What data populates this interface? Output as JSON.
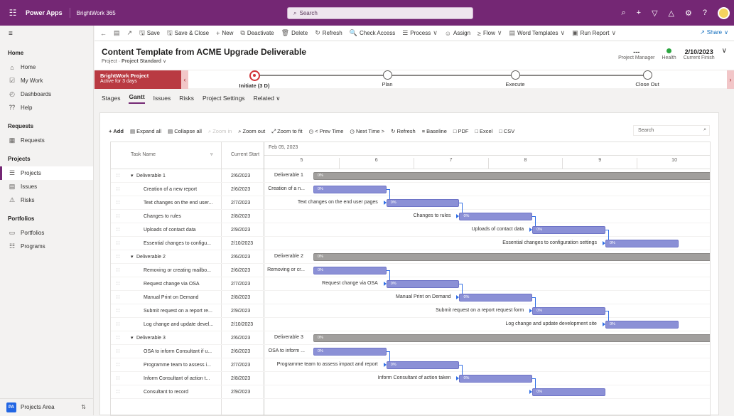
{
  "topbar": {
    "app": "Power Apps",
    "env": "BrightWork 365",
    "search_placeholder": "Search"
  },
  "sidebar": {
    "groups": [
      {
        "title": "Home",
        "items": [
          {
            "label": "Home",
            "icon": "home-icon"
          },
          {
            "label": "My Work",
            "icon": "checkbox-icon"
          },
          {
            "label": "Dashboards",
            "icon": "dashboard-icon"
          },
          {
            "label": "Help",
            "icon": "help-icon"
          }
        ]
      },
      {
        "title": "Requests",
        "items": [
          {
            "label": "Requests",
            "icon": "requests-icon"
          }
        ]
      },
      {
        "title": "Projects",
        "items": [
          {
            "label": "Projects",
            "icon": "projects-icon",
            "active": true
          },
          {
            "label": "Issues",
            "icon": "issues-icon"
          },
          {
            "label": "Risks",
            "icon": "warning-icon"
          }
        ]
      },
      {
        "title": "Portfolios",
        "items": [
          {
            "label": "Portfolios",
            "icon": "portfolio-icon"
          },
          {
            "label": "Programs",
            "icon": "programs-icon"
          }
        ]
      }
    ],
    "area": {
      "badge": "PA",
      "label": "Projects Area"
    }
  },
  "commands": [
    "Save",
    "Save & Close",
    "New",
    "Deactivate",
    "Delete",
    "Refresh",
    "Check Access",
    "Process",
    "Assign",
    "Flow",
    "Word Templates",
    "Run Report"
  ],
  "share": "Share",
  "header": {
    "title": "Content Template from ACME Upgrade Deliverable",
    "entity": "Project",
    "form": "Project Standard",
    "manager_value": "---",
    "manager_label": "Project Manager",
    "health_label": "Health",
    "finish_value": "2/10/2023",
    "finish_label": "Current Finish"
  },
  "bpf": {
    "name": "BrightWork Project",
    "active_for": "Active for 3 days",
    "stages": [
      "Initiate (3 D)",
      "Plan",
      "Execute",
      "Close Out"
    ]
  },
  "tabs": [
    "Stages",
    "Gantt",
    "Issues",
    "Risks",
    "Project Settings",
    "Related"
  ],
  "gantt": {
    "toolbar": [
      "Add",
      "Expand all",
      "Collapse all",
      "Zoom in",
      "Zoom out",
      "Zoom to fit",
      "< Prev Time",
      "Next Time >",
      "Refresh",
      "Baseline",
      "PDF",
      "Excel",
      "CSV"
    ],
    "search_placeholder": "Search",
    "col_task": "Task Name",
    "col_start": "Current Start",
    "week_label": "Feb 05, 2023",
    "days": [
      "5",
      "6",
      "7",
      "8",
      "9",
      "10"
    ],
    "rows": [
      {
        "name": "Deliverable 1",
        "start": "2/6/2023",
        "summary": true,
        "label": "Deliverable 1",
        "pct": "0%"
      },
      {
        "name": "Creation of a new report",
        "start": "2/6/2023",
        "label": "Creation of a n...",
        "pct": "0%",
        "day": 0
      },
      {
        "name": "Text changes on the end user...",
        "start": "2/7/2023",
        "label": "Text changes on the end user pages",
        "pct": "0%",
        "day": 1
      },
      {
        "name": "Changes to rules",
        "start": "2/8/2023",
        "label": "Changes to rules",
        "pct": "0%",
        "day": 2
      },
      {
        "name": "Uploads of contact data",
        "start": "2/9/2023",
        "label": "Uploads of contact data",
        "pct": "0%",
        "day": 3
      },
      {
        "name": "Essential changes to configu...",
        "start": "2/10/2023",
        "label": "Essential changes to configuration settings",
        "pct": "0%",
        "day": 4
      },
      {
        "name": "Deliverable 2",
        "start": "2/6/2023",
        "summary": true,
        "label": "Deliverable 2",
        "pct": "0%"
      },
      {
        "name": "Removing or creating mailbo...",
        "start": "2/6/2023",
        "label": "Removing or cr...",
        "pct": "0%",
        "day": 0
      },
      {
        "name": "Request change via OSA",
        "start": "2/7/2023",
        "label": "Request change via OSA",
        "pct": "0%",
        "day": 1
      },
      {
        "name": "Manual Print on Demand",
        "start": "2/8/2023",
        "label": "Manual Print on Demand",
        "pct": "0%",
        "day": 2
      },
      {
        "name": "Submit request on a report re...",
        "start": "2/9/2023",
        "label": "Submit request on a report request form",
        "pct": "0%",
        "day": 3
      },
      {
        "name": "Log change and update devel...",
        "start": "2/10/2023",
        "label": "Log change and update development site",
        "pct": "0%",
        "day": 4
      },
      {
        "name": "Deliverable 3",
        "start": "2/6/2023",
        "summary": true,
        "label": "Deliverable 3",
        "pct": "0%"
      },
      {
        "name": "OSA to inform Consultant if u...",
        "start": "2/6/2023",
        "label": "OSA to inform ...",
        "pct": "0%",
        "day": 0
      },
      {
        "name": "Programme team to assess i...",
        "start": "2/7/2023",
        "label": "Programme team to assess impact and report",
        "pct": "0%",
        "day": 1
      },
      {
        "name": "Inform Consultant of action t...",
        "start": "2/8/2023",
        "label": "Inform Consultant of action taken",
        "pct": "0%",
        "day": 2
      },
      {
        "name": "Consultant to record",
        "start": "2/9/2023",
        "label": "",
        "pct": "0%",
        "day": 3
      }
    ]
  }
}
